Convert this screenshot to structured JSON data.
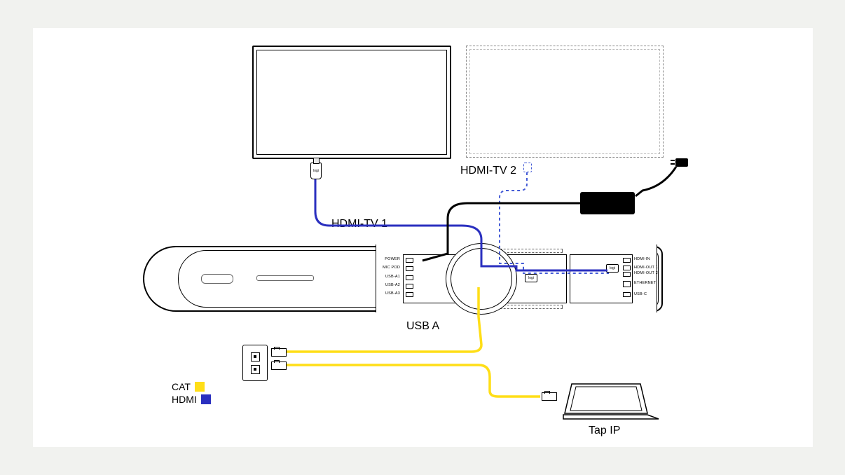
{
  "labels": {
    "hdmi_tv_1": "HDMI-TV 1",
    "hdmi_tv_2": "HDMI-TV 2",
    "usb_a": "USB A",
    "tap_ip": "Tap IP"
  },
  "legend": {
    "cat": {
      "label": "CAT",
      "color": "#ffde17"
    },
    "hdmi": {
      "label": "HDMI",
      "color": "#2a2fbf"
    }
  },
  "colors": {
    "cat_yellow": "#ffde17",
    "hdmi_blue": "#2a2fbf",
    "hdmi_blue_dash": "#445bd6",
    "power_black": "#000000"
  },
  "device_ports": {
    "left_col": [
      "POWER",
      "MIC POD",
      "USB-A1",
      "USB-A2",
      "USB-A3"
    ],
    "right_col": [
      "HDMI-IN",
      "HDMI-OUT 1",
      "HDMI-OUT 2",
      "ETHERNET",
      "USB-C"
    ]
  },
  "components": {
    "display_primary": "Primary display (HDMI-TV 1)",
    "display_secondary": "Optional second display (HDMI-TV 2)",
    "rally_bar": "Video bar with rear connection panel",
    "power_adapter": "External power adapter",
    "wall_plate": "Dual-port network wall plate",
    "tap_ip": "Tap IP touch controller"
  },
  "cabling": [
    {
      "name": "hdmi_tv1",
      "type": "HDMI",
      "from": "display_primary",
      "to": "rally_bar.HDMI-OUT 1",
      "style": "solid blue"
    },
    {
      "name": "hdmi_tv2",
      "type": "HDMI",
      "from": "display_secondary",
      "to": "rally_bar.HDMI-OUT 2",
      "style": "dashed blue (optional)"
    },
    {
      "name": "power",
      "type": "DC",
      "from": "power_adapter",
      "to": "rally_bar.POWER",
      "style": "solid black"
    },
    {
      "name": "cat_wall",
      "type": "CAT",
      "from": "rally_bar.ETHERNET",
      "to": "wall_plate (upper jack)",
      "style": "solid yellow"
    },
    {
      "name": "cat_tap",
      "type": "CAT",
      "from": "wall_plate (lower jack)",
      "to": "tap_ip",
      "style": "solid yellow"
    }
  ],
  "logi_text": "logi"
}
